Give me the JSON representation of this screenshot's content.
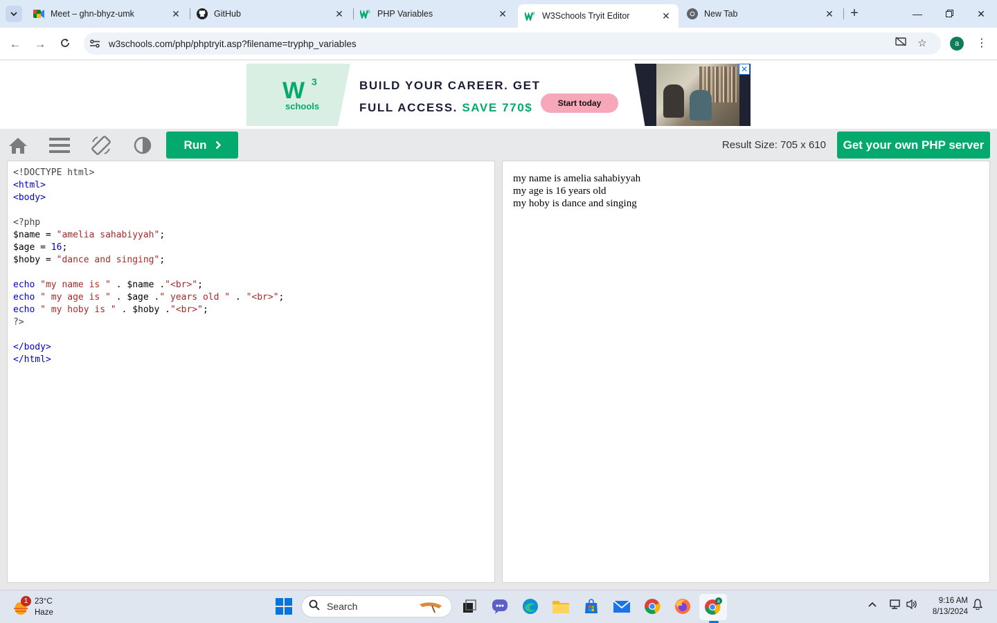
{
  "browser": {
    "tabs": [
      {
        "title": "Meet – ghn-bhyz-umk",
        "favicon": "google-meet-icon",
        "active": false
      },
      {
        "title": "GitHub",
        "favicon": "github-icon",
        "active": false
      },
      {
        "title": "PHP Variables",
        "favicon": "w3schools-icon",
        "active": false
      },
      {
        "title": "W3Schools Tryit Editor",
        "favicon": "w3schools-icon",
        "active": true
      },
      {
        "title": "New Tab",
        "favicon": "chrome-icon",
        "active": false
      }
    ],
    "url": "w3schools.com/php/phptryit.asp?filename=tryphp_variables",
    "profile_initial": "a"
  },
  "ad": {
    "logo_superscript": "3",
    "logo_letter": "W",
    "logo_text": "schools",
    "line1": "BUILD YOUR CAREER. GET",
    "line2_start": "FULL ACCESS.",
    "line2_highlight": "SAVE 770$",
    "button": "Start today",
    "close": "✕"
  },
  "tryit": {
    "run_label": "Run",
    "result_size": "Result Size: 705 x 610",
    "get_server": "Get your own PHP server"
  },
  "code": {
    "lines": [
      [
        {
          "t": "<!DOCTYPE html>",
          "c": "php"
        }
      ],
      [
        {
          "t": "<html>",
          "c": "tag"
        }
      ],
      [
        {
          "t": "<body>",
          "c": "tag"
        }
      ],
      [],
      [
        {
          "t": "<?php",
          "c": "php"
        }
      ],
      [
        {
          "t": "$name = ",
          "c": ""
        },
        {
          "t": "\"amelia sahabiyyah\"",
          "c": "str"
        },
        {
          "t": ";",
          "c": ""
        }
      ],
      [
        {
          "t": "$age = ",
          "c": ""
        },
        {
          "t": "16",
          "c": "kw"
        },
        {
          "t": ";",
          "c": ""
        }
      ],
      [
        {
          "t": "$hoby = ",
          "c": ""
        },
        {
          "t": "\"dance and singing\"",
          "c": "str"
        },
        {
          "t": ";",
          "c": ""
        }
      ],
      [],
      [
        {
          "t": "echo",
          "c": "kw"
        },
        {
          "t": " ",
          "c": ""
        },
        {
          "t": "\"my name is \"",
          "c": "str"
        },
        {
          "t": " . $name .",
          "c": ""
        },
        {
          "t": "\"<br>\"",
          "c": "str"
        },
        {
          "t": ";",
          "c": ""
        }
      ],
      [
        {
          "t": "echo",
          "c": "kw"
        },
        {
          "t": " ",
          "c": ""
        },
        {
          "t": "\" my age is \"",
          "c": "str"
        },
        {
          "t": " . $age .",
          "c": ""
        },
        {
          "t": "\" years old \"",
          "c": "str"
        },
        {
          "t": " . ",
          "c": ""
        },
        {
          "t": "\"<br>\"",
          "c": "str"
        },
        {
          "t": ";",
          "c": ""
        }
      ],
      [
        {
          "t": "echo",
          "c": "kw"
        },
        {
          "t": " ",
          "c": ""
        },
        {
          "t": "\" my hoby is \"",
          "c": "str"
        },
        {
          "t": " . $hoby .",
          "c": ""
        },
        {
          "t": "\"<br>\"",
          "c": "str"
        },
        {
          "t": ";",
          "c": ""
        }
      ],
      [
        {
          "t": "?>",
          "c": "php"
        }
      ],
      [],
      [
        {
          "t": "</body>",
          "c": "tag"
        }
      ],
      [
        {
          "t": "</html>",
          "c": "tag"
        }
      ]
    ]
  },
  "result": {
    "lines": [
      "my name is amelia sahabiyyah",
      "my age is 16 years old",
      "my hoby is dance and singing"
    ]
  },
  "taskbar": {
    "weather_temp": "23°C",
    "weather_desc": "Haze",
    "weather_badge": "1",
    "search_label": "Search",
    "time": "9:16 AM",
    "date": "8/13/2024"
  },
  "colors": {
    "w3_green": "#04aa6d",
    "tab_strip": "#dee9f7",
    "ad_pink": "#f7a8b8"
  }
}
